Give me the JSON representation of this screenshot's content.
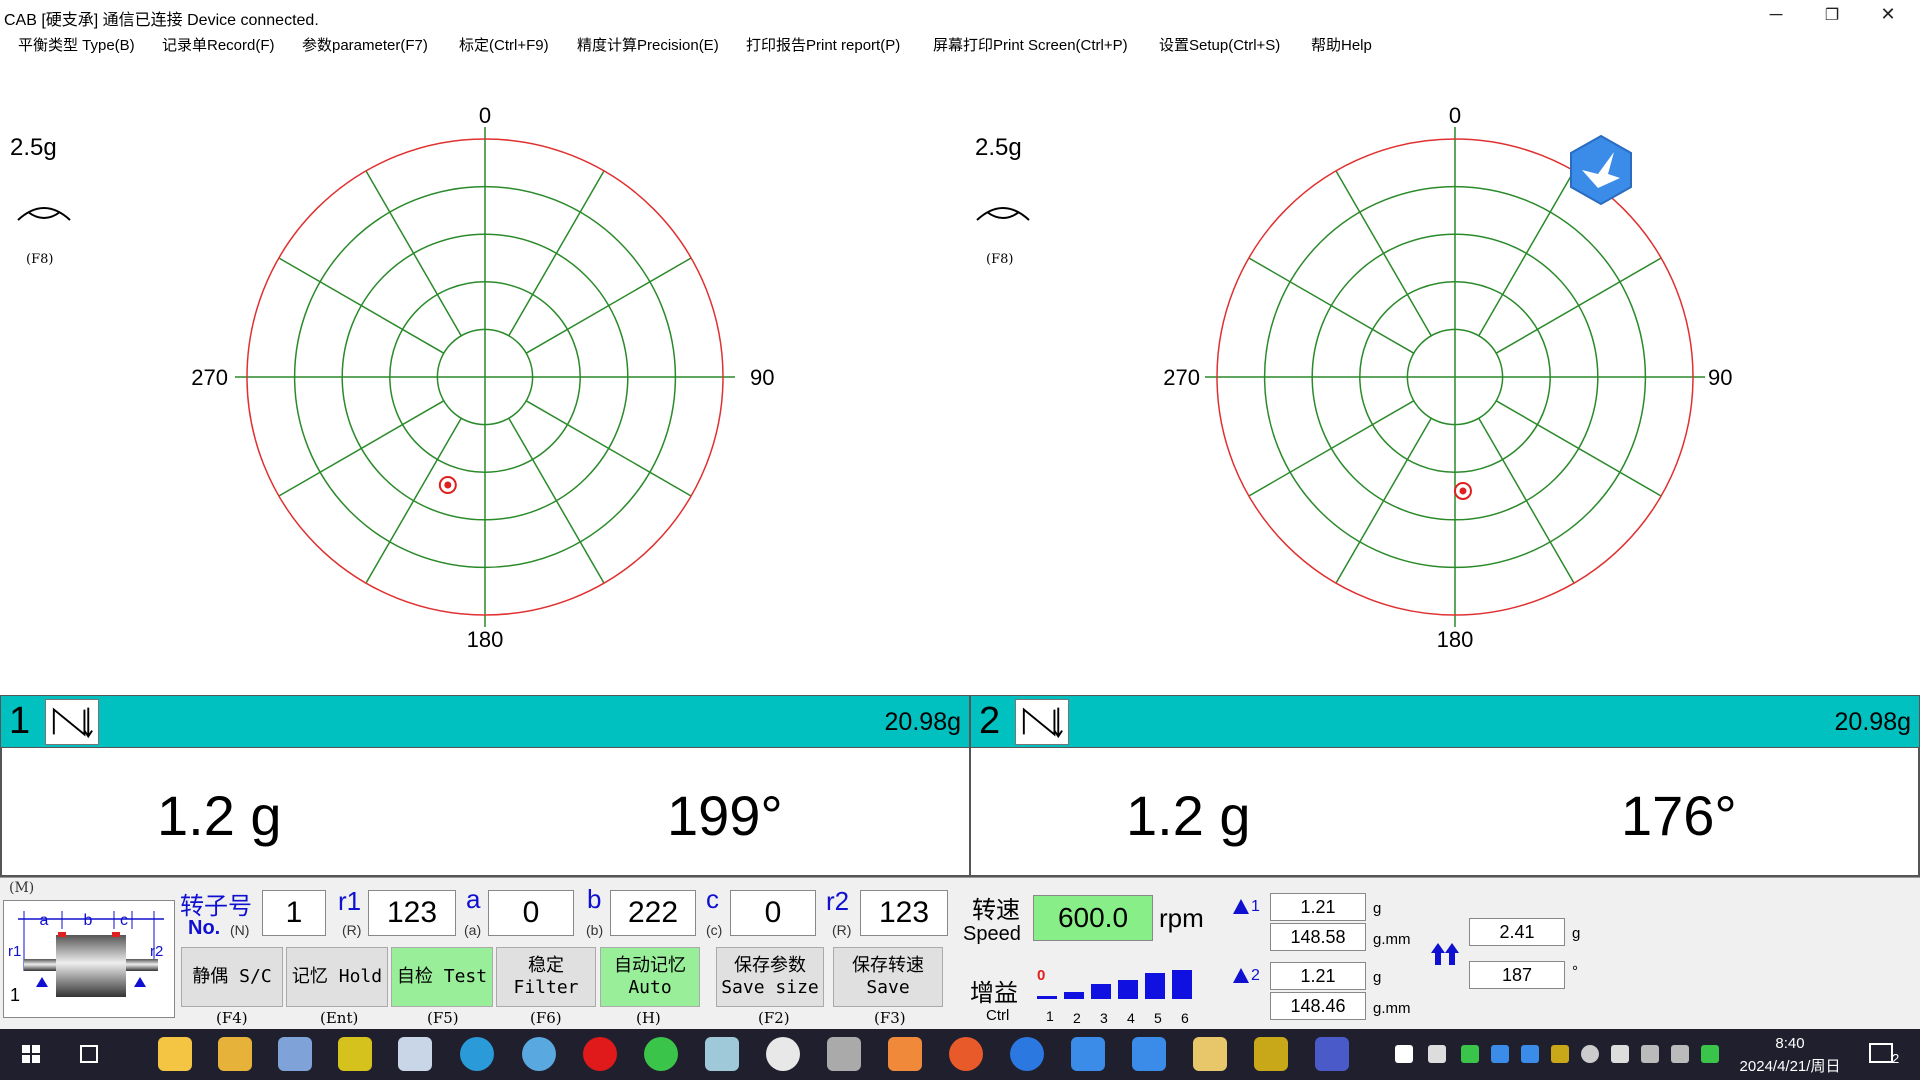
{
  "window": {
    "title": "CAB [硬支承]   通信已连接 Device connected.",
    "minimize": "─",
    "restore": "❐",
    "close": "✕"
  },
  "menu": [
    "平衡类型 Type(B)",
    "记录单Record(F)",
    "参数parameter(F7)",
    "标定(Ctrl+F9)",
    "精度计算Precision(E)",
    "打印报告Print report(P)",
    "屏幕打印Print Screen(Ctrl+P)",
    "设置Setup(Ctrl+S)",
    "帮助Help"
  ],
  "left_plot": {
    "scale": "2.5g",
    "f8": "(F8)",
    "deg_top": "0",
    "deg_right": "90",
    "deg_bottom": "180",
    "deg_left": "270",
    "point": {
      "magnitude_g": 1.2,
      "angle_deg": 199
    }
  },
  "right_plot": {
    "scale": "2.5g",
    "f8": "(F8)",
    "deg_top": "0",
    "deg_right": "90",
    "deg_bottom": "180",
    "deg_left": "270",
    "point": {
      "magnitude_g": 1.2,
      "angle_deg": 176
    }
  },
  "channel1": {
    "num": "1",
    "total": "20.98g",
    "mass": "1.2  g",
    "angle": "199°"
  },
  "channel2": {
    "num": "2",
    "total": "20.98g",
    "mass": "1.2  g",
    "angle": "176°"
  },
  "params": {
    "m_label": "(M)",
    "rotor_label": "转子号",
    "rotor_no": "No.",
    "rotor_key": "(N)",
    "rotor_value": "1",
    "r1_label": "r1",
    "r1_key": "(R)",
    "r1_value": "123",
    "a_label": "a",
    "a_key": "(a)",
    "a_value": "0",
    "b_label": "b",
    "b_key": "(b)",
    "b_value": "222",
    "c_label": "c",
    "c_key": "(c)",
    "c_value": "0",
    "r2_label": "r2",
    "r2_key": "(R)",
    "r2_value": "123",
    "diagram_a": "a",
    "diagram_b": "b",
    "diagram_c": "c",
    "diagram_r1": "r1",
    "diagram_r2": "r2",
    "diagram_1": "1"
  },
  "buttons": [
    {
      "l1": "静偶 S/C",
      "l2": "",
      "key": "(F4)"
    },
    {
      "l1": "记忆 Hold",
      "l2": "",
      "key": "(Ent)"
    },
    {
      "l1": "自检 Test",
      "l2": "",
      "key": "(F5)"
    },
    {
      "l1": "稳定",
      "l2": "Filter",
      "key": "(F6)"
    },
    {
      "l1": "自动记忆",
      "l2": "Auto",
      "key": "(H)"
    },
    {
      "l1": "保存参数",
      "l2": "Save size",
      "key": "(F2)"
    },
    {
      "l1": "保存转速",
      "l2": "Save",
      "key": "(F3)"
    }
  ],
  "speed": {
    "label_cn": "转速",
    "label_en": "Speed",
    "value": "600.0",
    "unit": "rpm"
  },
  "gain": {
    "label_cn": "增益",
    "label_en": "Ctrl",
    "current": "0",
    "levels": [
      "1",
      "2",
      "3",
      "4",
      "5",
      "6"
    ]
  },
  "results": {
    "p1_label": "1",
    "p1_mass": "1.21",
    "p1_mass_unit": "g",
    "p1_moment": "148.58",
    "p1_moment_unit": "g.mm",
    "p2_label": "2",
    "p2_mass": "1.21",
    "p2_mass_unit": "g",
    "p2_moment": "148.46",
    "p2_moment_unit": "g.mm",
    "static_mass": "2.41",
    "static_mass_unit": "g",
    "static_angle": "187",
    "static_angle_unit": "°"
  },
  "taskbar": {
    "time": "8:40",
    "date": "2024/4/21/周日",
    "notif": "2"
  },
  "colors": {
    "accent_bar": "#00c0c0",
    "grid": "#2a8a2a",
    "outer_ring": "#e03030",
    "button_green": "#99ee99",
    "speed_bg": "#88ee88",
    "label_blue": "#1010d0"
  }
}
